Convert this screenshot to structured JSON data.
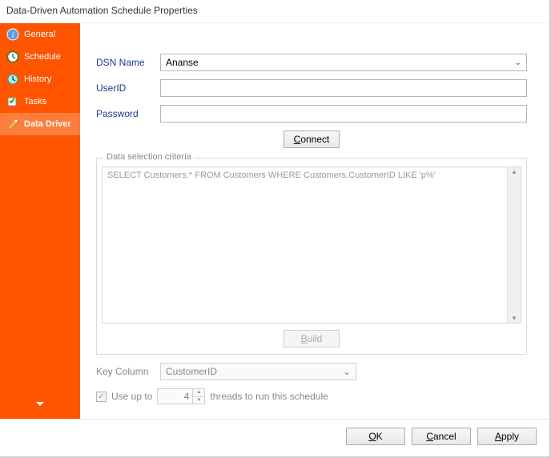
{
  "window": {
    "title": "Data-Driven Automation Schedule Properties"
  },
  "sidebar": {
    "items": [
      {
        "label": "General"
      },
      {
        "label": "Schedule"
      },
      {
        "label": "History"
      },
      {
        "label": "Tasks"
      },
      {
        "label": "Data Driver"
      }
    ]
  },
  "form": {
    "dsn_label": "DSN Name",
    "dsn_value": "Ananse",
    "userid_label": "UserID",
    "userid_value": "",
    "password_label": "Password",
    "password_value": "",
    "connect_label": "Connect"
  },
  "criteria": {
    "legend": "Data selection criteria",
    "sql": "SELECT Customers.* FROM Customers WHERE Customers.CustomerID LIKE 'p%'",
    "build_label": "Build"
  },
  "key": {
    "label": "Key Column",
    "value": "CustomerID"
  },
  "threads": {
    "checkbox_label": "Use up to",
    "value": "4",
    "suffix": "threads to run this schedule",
    "checked": true
  },
  "footer": {
    "ok": "OK",
    "cancel": "Cancel",
    "apply": "Apply"
  }
}
